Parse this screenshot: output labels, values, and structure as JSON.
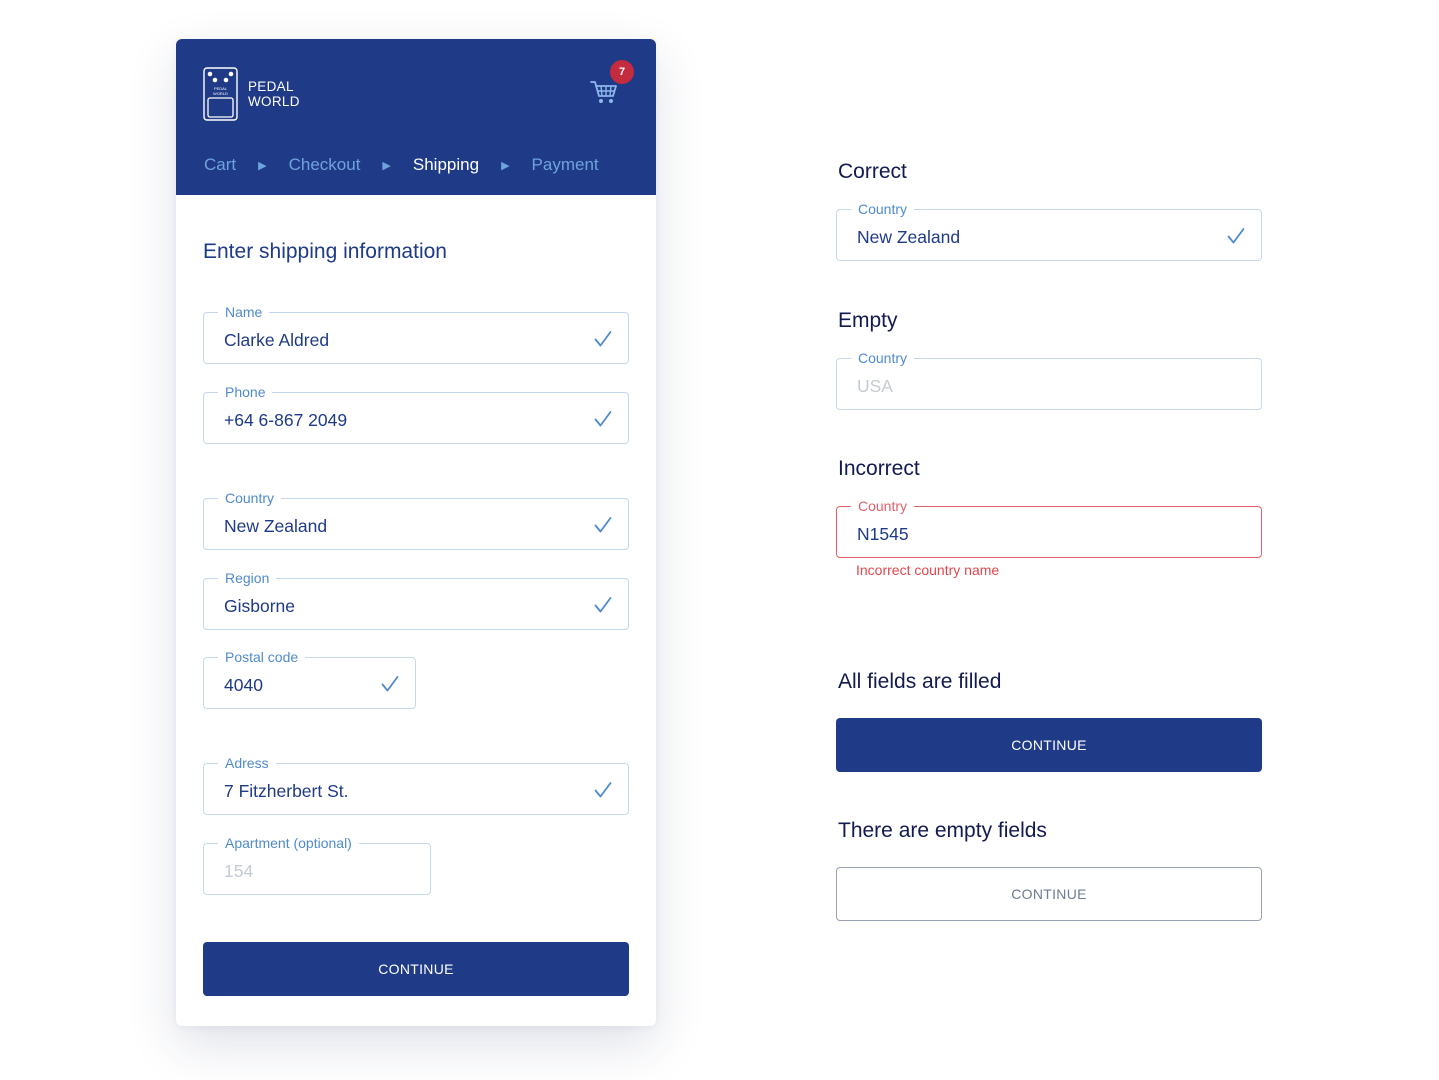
{
  "brand": {
    "line1": "PEDAL",
    "line2": "WORLD",
    "pedal_line1": "PEDAL",
    "pedal_line2": "WORLD"
  },
  "cart": {
    "count": "7"
  },
  "breadcrumbs": [
    {
      "label": "Cart",
      "active": false
    },
    {
      "label": "Checkout",
      "active": false
    },
    {
      "label": "Shipping",
      "active": true
    },
    {
      "label": "Payment",
      "active": false
    }
  ],
  "form": {
    "title": "Enter shipping information",
    "fields": {
      "name": {
        "label": "Name",
        "value": "Clarke Aldred"
      },
      "phone": {
        "label": "Phone",
        "value": "+64 6-867 2049"
      },
      "country": {
        "label": "Country",
        "value": "New Zealand"
      },
      "region": {
        "label": "Region",
        "value": "Gisborne"
      },
      "postal": {
        "label": "Postal code",
        "value": "4040"
      },
      "address": {
        "label": "Adress",
        "value": "7 Fitzherbert St."
      },
      "apartment": {
        "label": "Apartment (optional)",
        "placeholder": "154"
      }
    },
    "continue_label": "CONTINUE"
  },
  "states": {
    "correct": {
      "title": "Correct",
      "label": "Country",
      "value": "New Zealand"
    },
    "empty": {
      "title": "Empty",
      "label": "Country",
      "placeholder": "USA"
    },
    "incorrect": {
      "title": "Incorrect",
      "label": "Country",
      "value": "N1545",
      "error": "Incorrect country name"
    },
    "all_filled": {
      "title": "All fields are filled",
      "button": "CONTINUE"
    },
    "empty_fields": {
      "title": "There are empty fields",
      "button": "CONTINUE"
    }
  },
  "colors": {
    "primary": "#1f3a87",
    "accent": "#4f8acf",
    "error": "#e0616b",
    "badge": "#c42b3f"
  }
}
